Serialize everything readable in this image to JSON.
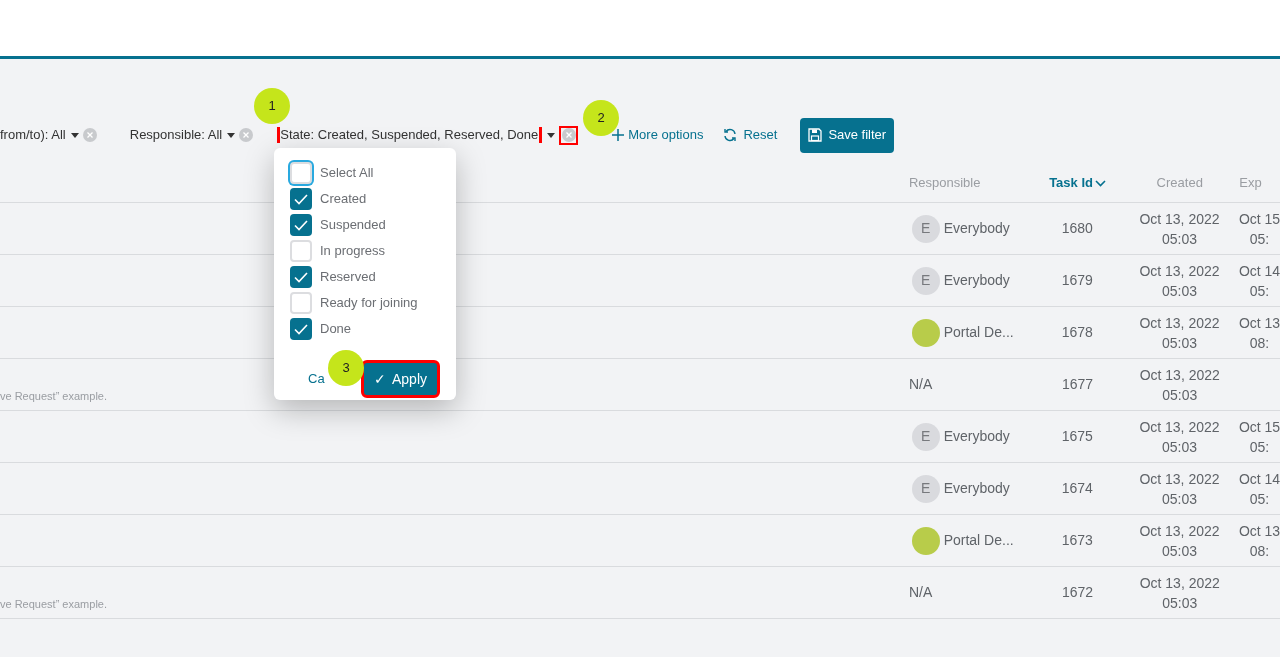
{
  "filter_bar": {
    "filters": [
      {
        "label": "from/to): All",
        "highlighted": false
      },
      {
        "label": "Responsible: All",
        "highlighted": false
      },
      {
        "label": "State: Created, Suspended, Reserved, Done",
        "highlighted": true
      }
    ],
    "more_options": "More options",
    "reset": "Reset",
    "save_filter": "Save filter"
  },
  "state_dropdown": {
    "options": [
      {
        "label": "Select All",
        "checked": false,
        "focused": true
      },
      {
        "label": "Created",
        "checked": true,
        "focused": false
      },
      {
        "label": "Suspended",
        "checked": true,
        "focused": false
      },
      {
        "label": "In progress",
        "checked": false,
        "focused": false
      },
      {
        "label": "Reserved",
        "checked": true,
        "focused": false
      },
      {
        "label": "Ready for joining",
        "checked": false,
        "focused": false
      },
      {
        "label": "Done",
        "checked": true,
        "focused": false
      }
    ],
    "cancel": "Ca",
    "apply_icon": "✓",
    "apply": "Apply",
    "apply_highlighted": true
  },
  "callouts": [
    {
      "number": "1"
    },
    {
      "number": "2"
    },
    {
      "number": "3"
    }
  ],
  "table": {
    "columns": [
      {
        "label": "Responsible",
        "sorted": false
      },
      {
        "label": "Task Id",
        "sorted": true
      },
      {
        "label": "Created",
        "sorted": false
      },
      {
        "label": "Exp",
        "sorted": false
      }
    ],
    "rows": [
      {
        "note": "",
        "responsible": {
          "kind": "initial",
          "initial": "E",
          "name": "Everybody"
        },
        "task_id": "1680",
        "created": [
          "Oct 13, 2022",
          "05:03"
        ],
        "expires": [
          "Oct 15",
          "05:"
        ]
      },
      {
        "note": "",
        "responsible": {
          "kind": "initial",
          "initial": "E",
          "name": "Everybody"
        },
        "task_id": "1679",
        "created": [
          "Oct 13, 2022",
          "05:03"
        ],
        "expires": [
          "Oct 14",
          "05:"
        ]
      },
      {
        "note": "",
        "responsible": {
          "kind": "photo",
          "name": "Portal De..."
        },
        "task_id": "1678",
        "created": [
          "Oct 13, 2022",
          "05:03"
        ],
        "expires": [
          "Oct 13",
          "08:"
        ]
      },
      {
        "note": "ve Request” example.",
        "responsible": {
          "kind": "none",
          "name": "N/A"
        },
        "task_id": "1677",
        "created": [
          "Oct 13, 2022",
          "05:03"
        ],
        "expires": []
      },
      {
        "note": "",
        "responsible": {
          "kind": "initial",
          "initial": "E",
          "name": "Everybody"
        },
        "task_id": "1675",
        "created": [
          "Oct 13, 2022",
          "05:03"
        ],
        "expires": [
          "Oct 15",
          "05:"
        ]
      },
      {
        "note": "",
        "responsible": {
          "kind": "initial",
          "initial": "E",
          "name": "Everybody"
        },
        "task_id": "1674",
        "created": [
          "Oct 13, 2022",
          "05:03"
        ],
        "expires": [
          "Oct 14",
          "05:"
        ]
      },
      {
        "note": "",
        "responsible": {
          "kind": "photo",
          "name": "Portal De..."
        },
        "task_id": "1673",
        "created": [
          "Oct 13, 2022",
          "05:03"
        ],
        "expires": [
          "Oct 13",
          "08:"
        ]
      },
      {
        "note": "ve Request” example.",
        "responsible": {
          "kind": "none",
          "name": "N/A"
        },
        "task_id": "1672",
        "created": [
          "Oct 13, 2022",
          "05:03"
        ],
        "expires": []
      }
    ]
  }
}
